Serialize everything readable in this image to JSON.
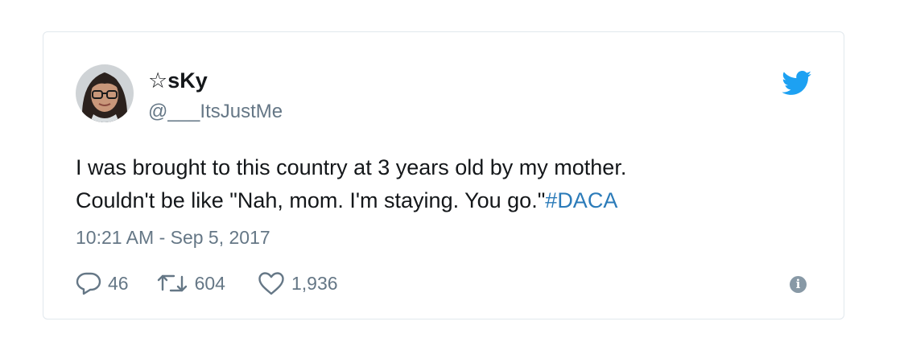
{
  "tweet": {
    "author": {
      "display_name": "☆sKy",
      "handle": "@___ItsJustMe"
    },
    "text_line1": "I was brought to this country at 3 years old by my mother.",
    "text_line2": "Couldn't be like \"Nah, mom. I'm staying. You go.\"",
    "hashtag": "#DACA",
    "timestamp": "10:21 AM - Sep 5, 2017",
    "reply_count": "46",
    "retweet_count": "604",
    "like_count": "1,936",
    "info_symbol": "i"
  },
  "icons": {
    "reply": "reply-icon",
    "retweet": "retweet-icon",
    "like": "heart-icon",
    "brand": "twitter-bird-icon",
    "info": "info-icon"
  },
  "colors": {
    "brand_blue": "#1da1f2",
    "link_blue": "#2b7bb9",
    "muted_gray": "#657786",
    "text": "#14171a",
    "border": "#e1e8ed"
  }
}
